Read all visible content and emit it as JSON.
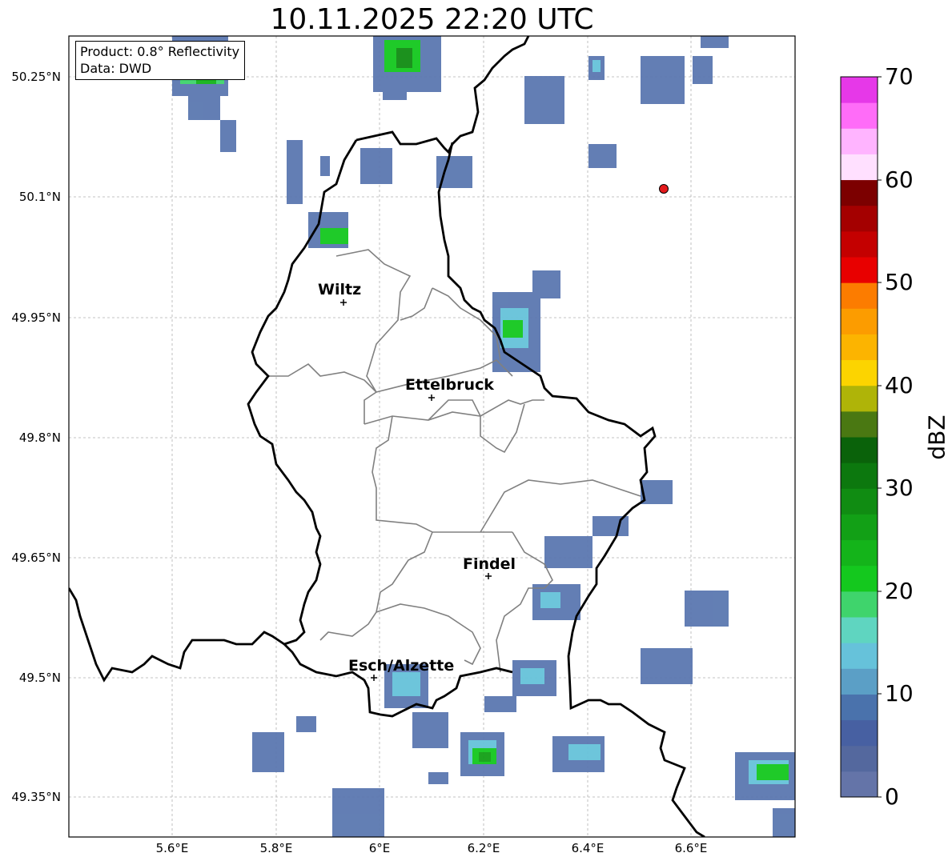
{
  "title": "10.11.2025 22:20 UTC",
  "info_box": {
    "product": "Product: 0.8° Reflectivity",
    "source": "Data: DWD"
  },
  "lat_ticks": [
    "50.25°N",
    "50.1°N",
    "49.95°N",
    "49.8°N",
    "49.65°N",
    "49.5°N",
    "49.35°N"
  ],
  "lon_ticks": [
    "5.6°E",
    "5.8°E",
    "6°E",
    "6.2°E",
    "6.4°E",
    "6.6°E"
  ],
  "cities": [
    {
      "name": "Wiltz"
    },
    {
      "name": "Ettelbruck"
    },
    {
      "name": "Findel"
    },
    {
      "name": "Esch/Alzette"
    }
  ],
  "colorbar": {
    "label": "dBZ",
    "ticks": [
      "70",
      "60",
      "50",
      "40",
      "30",
      "20",
      "10",
      "0"
    ],
    "colors": [
      "#6474a8",
      "#54689e",
      "#4760a2",
      "#4a72ac",
      "#5b9fc6",
      "#66c2da",
      "#5fd5c0",
      "#3fd46c",
      "#14c81e",
      "#14b41a",
      "#12a016",
      "#108c12",
      "#0c780e",
      "#0a620a",
      "#4a7812",
      "#afb408",
      "#fcd400",
      "#fcb400",
      "#fc9c00",
      "#fc7c00",
      "#e80000",
      "#c40000",
      "#a40000",
      "#7c0000",
      "#ffe0ff",
      "#ffb4ff",
      "#ff6cf8",
      "#e638e8"
    ]
  },
  "marker": {
    "name": "radar-site",
    "color": "#e41a1c"
  }
}
